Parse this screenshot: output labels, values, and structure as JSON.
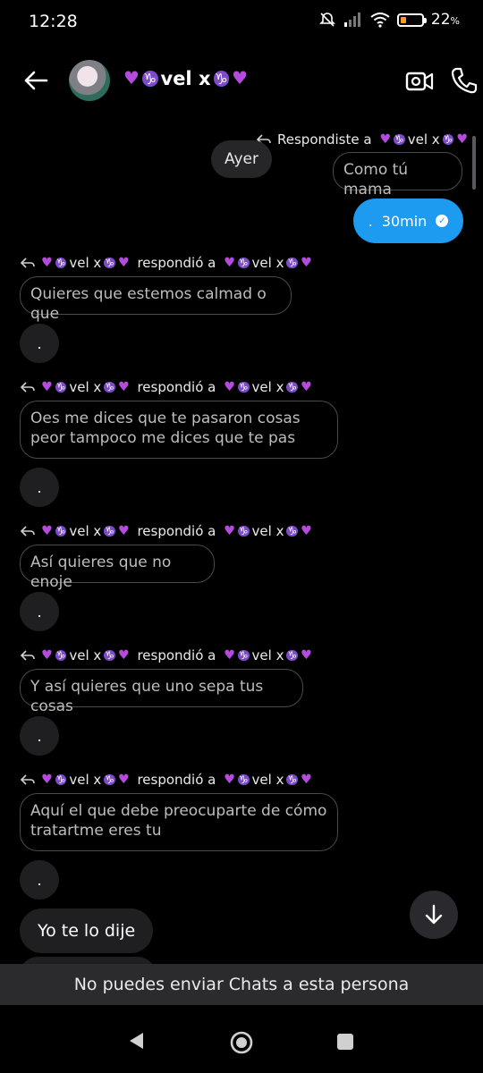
{
  "status": {
    "time": "12:28",
    "battery": "22"
  },
  "header": {
    "name_text_1": "vel x"
  },
  "thread": {
    "my_reply_label": "Respondiste a",
    "my_reply_name": "vel x",
    "my_quote": "Como tú mama",
    "day": "Ayer",
    "my_message": ".",
    "my_message_time": "30min",
    "replied_to": "respondió a",
    "user_part": "vel x",
    "items": [
      {
        "quote": "Quieres que estemos calmad o que",
        "reply": "."
      },
      {
        "quote": "Oes me dices que te pasaron cosas peor tampoco me dices que te pas",
        "reply": "."
      },
      {
        "quote": "Así quieres que no enoje",
        "reply": "."
      },
      {
        "quote": "Y así quieres que uno sepa tus cosas",
        "reply": "."
      },
      {
        "quote": "Aquí el que debe preocuparte de cómo tratartme eres tu",
        "reply": "."
      }
    ],
    "last_message": "Yo te lo dije"
  },
  "notice": "No puedes enviar Chats a esta persona",
  "colors": {
    "accent": "#1d9bf0",
    "heart": "#b44bdc",
    "capricorn": "#7d4bc9"
  }
}
